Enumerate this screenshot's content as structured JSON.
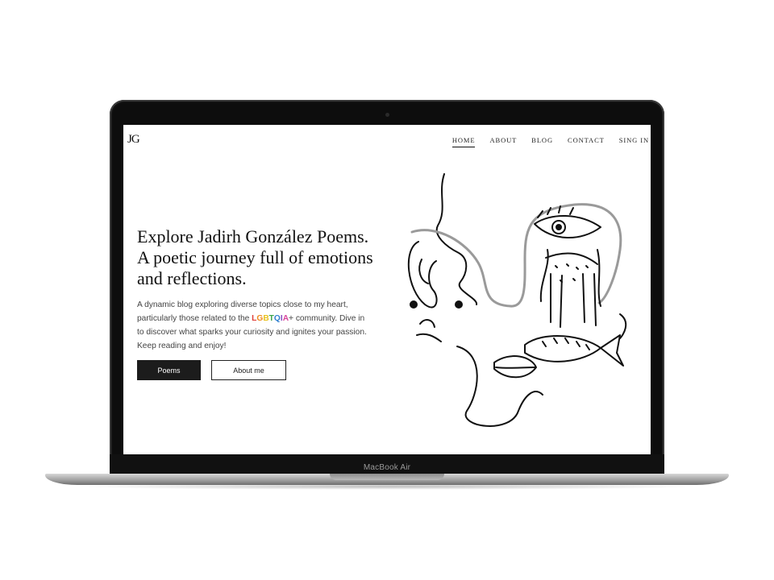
{
  "device": {
    "model_label": "MacBook Air"
  },
  "site": {
    "logo": "JG",
    "nav": [
      {
        "label": "HOME",
        "active": true
      },
      {
        "label": "ABOUT",
        "active": false
      },
      {
        "label": "BLOG",
        "active": false
      },
      {
        "label": "CONTACT",
        "active": false
      },
      {
        "label": "SING IN",
        "active": false
      }
    ],
    "hero": {
      "title": "Explore Jadirh González Poems. A poetic journey full of emotions and reflections.",
      "desc_before": "A dynamic blog exploring diverse topics close to my heart, particularly those related to the ",
      "desc_highlight": "LGBTQIA+",
      "desc_after": " community. Dive in to discover what sparks your curiosity and ignites your passion. Keep reading and enjoy!",
      "primary_button": "Poems",
      "secondary_button": "About me"
    },
    "highlight_colors": [
      "#e0413b",
      "#f08a1d",
      "#e8c21d",
      "#3da34a",
      "#2f7fd0",
      "#8a4fc1",
      "#d9449b",
      "#7a7a7a"
    ]
  }
}
